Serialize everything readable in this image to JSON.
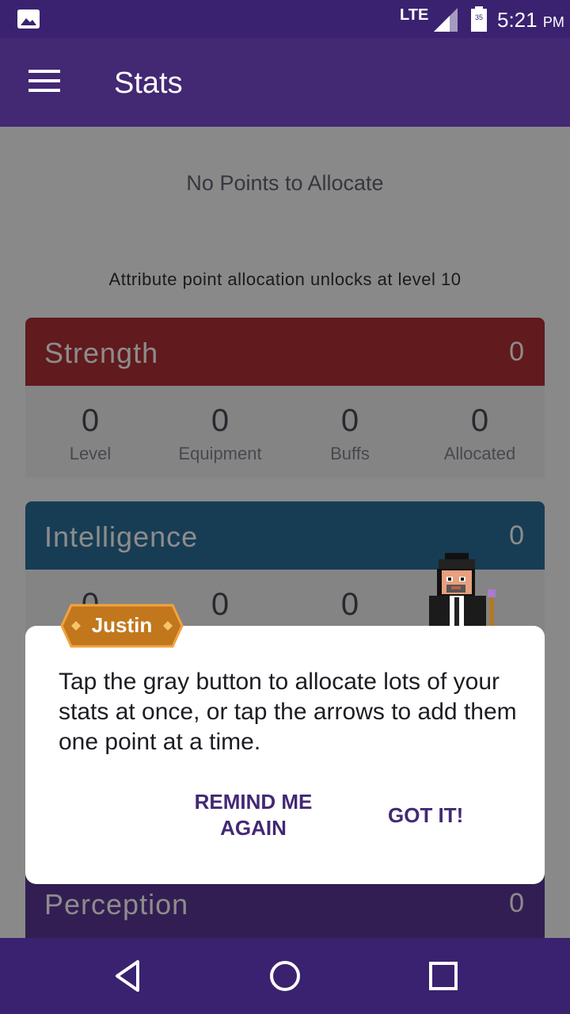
{
  "status_bar": {
    "network": "LTE",
    "battery_level": "35",
    "time": "5:21",
    "ampm": "PM"
  },
  "app_bar": {
    "title": "Stats"
  },
  "allocation": {
    "no_points": "No Points to Allocate",
    "unlock_message": "Attribute point allocation unlocks at level 10"
  },
  "stats": [
    {
      "name": "Strength",
      "total": "0",
      "color": "#b13135",
      "columns": [
        {
          "value": "0",
          "label": "Level"
        },
        {
          "value": "0",
          "label": "Equipment"
        },
        {
          "value": "0",
          "label": "Buffs"
        },
        {
          "value": "0",
          "label": "Allocated"
        }
      ]
    },
    {
      "name": "Intelligence",
      "total": "0",
      "color": "#2a6f99",
      "columns": [
        {
          "value": "0"
        },
        {
          "value": "0"
        },
        {
          "value": "0"
        }
      ]
    },
    {
      "name": "Perception",
      "total": "0",
      "color": "#5c3896"
    }
  ],
  "dialog": {
    "npc_name": "Justin",
    "message": "Tap the gray button to allocate lots of your stats at once, or tap the arrows to add them one point at a time.",
    "remind_line1": "REMIND ME",
    "remind_line2": "AGAIN",
    "confirm_button": "GOT IT!"
  },
  "colors": {
    "primary": "#432874",
    "status_bar": "#3a2271",
    "badge": "#c2771c",
    "badge_border": "#f2a33e"
  },
  "nav_bar": {
    "icons": [
      "back-icon",
      "home-icon",
      "recents-icon"
    ]
  }
}
